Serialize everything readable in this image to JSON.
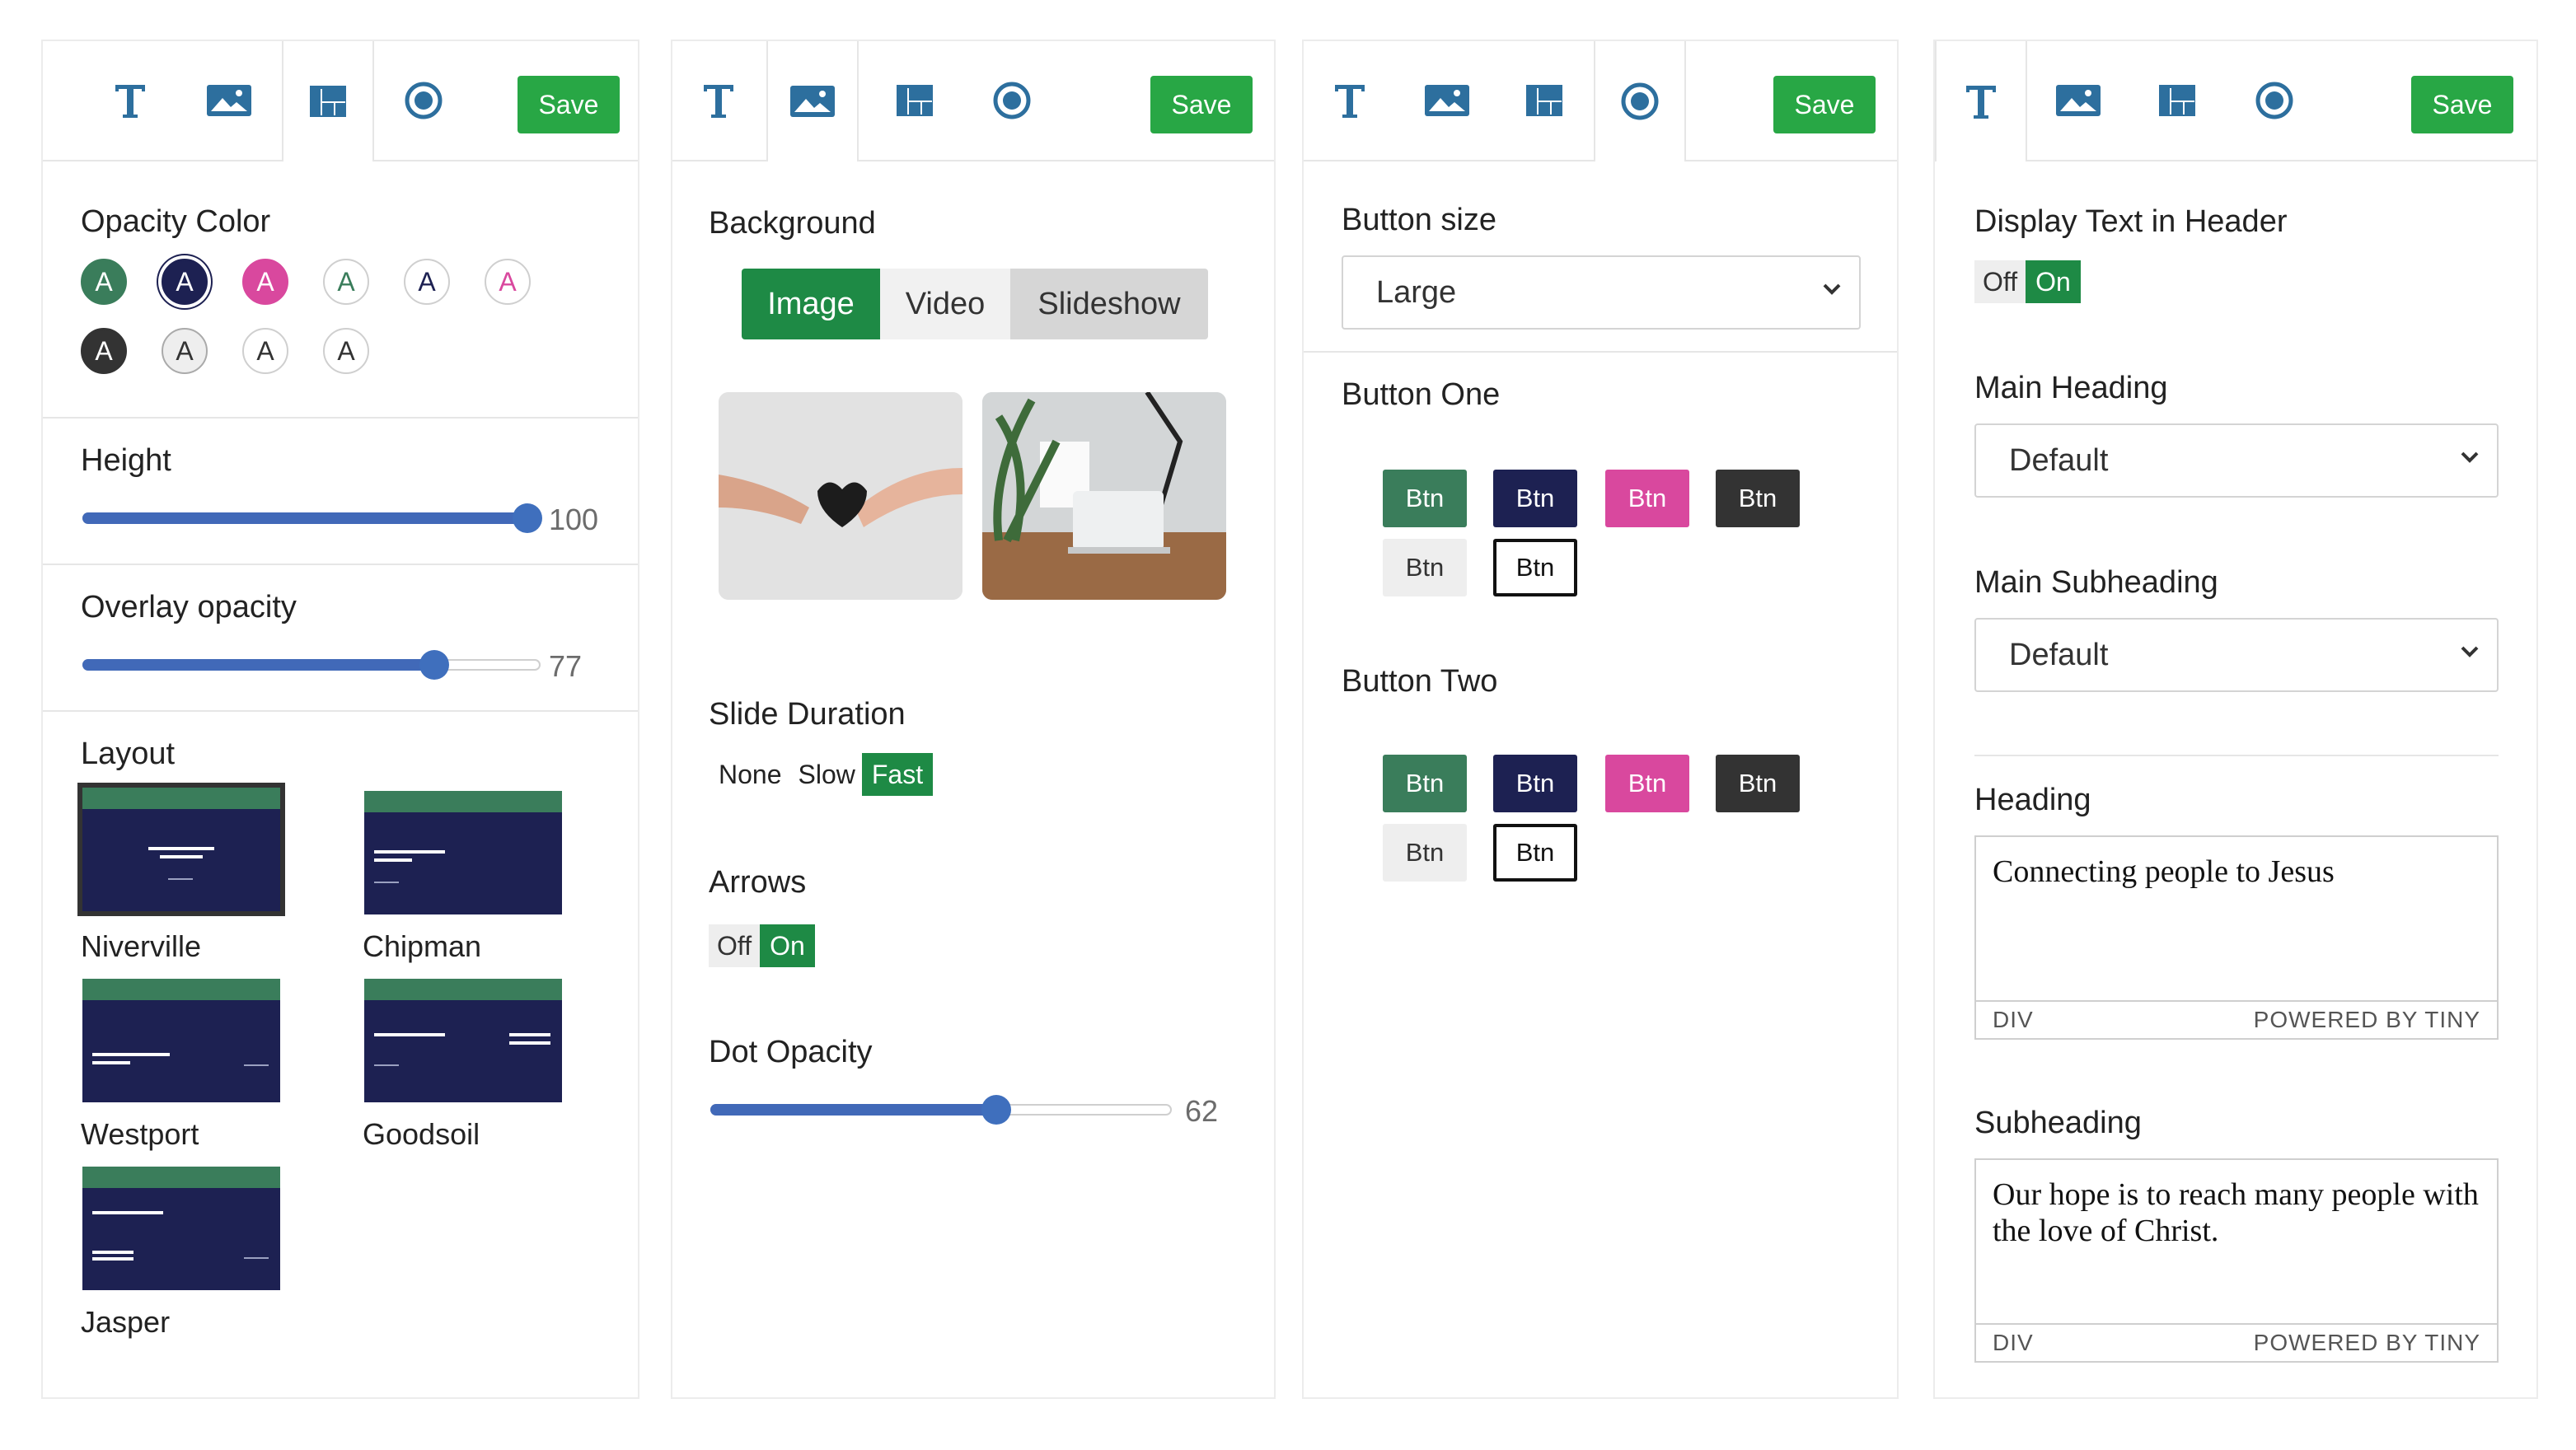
{
  "colors": {
    "accent_blue": "#2d6f9e",
    "save_green": "#28a745",
    "toggle_green": "#1e8a45",
    "slider_blue": "#4169b8",
    "teal": "#3a7d5b",
    "navy": "#1d2152",
    "pink": "#d9489e",
    "dark": "#333333"
  },
  "common": {
    "save_label": "Save",
    "btn_label": "Btn",
    "circle_letter": "A",
    "tab_icons": [
      "text-icon",
      "image-icon",
      "layout-icon",
      "button-icon"
    ]
  },
  "panel1": {
    "opacity_color_title": "Opacity Color",
    "height_title": "Height",
    "height_value": "100",
    "height_fraction": 1.0,
    "overlay_title": "Overlay opacity",
    "overlay_value": "77",
    "overlay_fraction": 0.77,
    "layout_title": "Layout",
    "layouts": [
      "Niverville",
      "Chipman",
      "Westport",
      "Goodsoil",
      "Jasper"
    ],
    "selected_layout": "Niverville"
  },
  "panel2": {
    "background_title": "Background",
    "bg_options": [
      "Image",
      "Video",
      "Slideshow"
    ],
    "bg_selected": "Image",
    "slide_duration_title": "Slide Duration",
    "durations": [
      "None",
      "Slow",
      "Fast"
    ],
    "duration_selected": "Fast",
    "arrows_title": "Arrows",
    "toggle_off": "Off",
    "toggle_on": "On",
    "dot_opacity_title": "Dot Opacity",
    "dot_opacity_value": "62",
    "dot_opacity_fraction": 0.62
  },
  "panel3": {
    "button_size_title": "Button size",
    "button_size_value": "Large",
    "button_one_title": "Button One",
    "button_two_title": "Button Two"
  },
  "panel4": {
    "display_text_title": "Display Text in Header",
    "toggle_off": "Off",
    "toggle_on": "On",
    "main_heading_title": "Main Heading",
    "main_heading_value": "Default",
    "main_subheading_title": "Main Subheading",
    "main_subheading_value": "Default",
    "heading_title": "Heading",
    "heading_text": "Connecting people to Jesus",
    "subheading_title": "Subheading",
    "subheading_text": "Our hope is to reach many people with the love of Christ.",
    "editor_path": "DIV",
    "editor_brand": "POWERED BY TINY"
  }
}
